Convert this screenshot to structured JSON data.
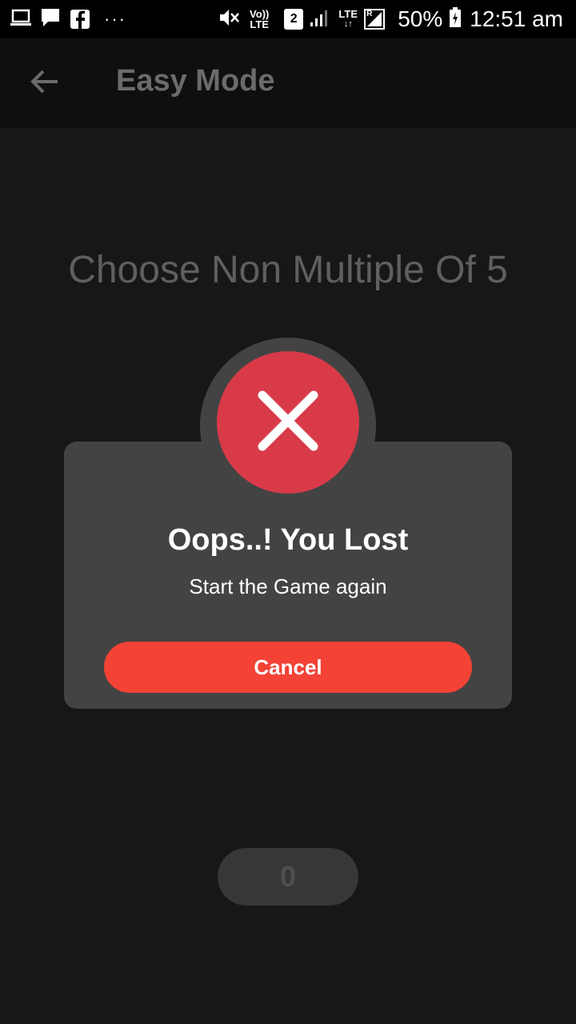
{
  "status_bar": {
    "battery_percent": "50%",
    "time": "12:51 am",
    "volte_label_top": "Vo))",
    "volte_label_bottom": "LTE",
    "sim_slot": "2",
    "lte_label": "LTE",
    "roaming_label": "R",
    "more_dots": "···",
    "icons": {
      "laptop": "laptop-icon",
      "chat": "chat-icon",
      "facebook": "facebook-icon",
      "mute": "mute-icon",
      "signal": "signal-icon",
      "battery": "battery-icon"
    }
  },
  "app_bar": {
    "title": "Easy Mode",
    "back_icon": "arrow-left-icon"
  },
  "game": {
    "prompt": "Choose Non Multiple Of 5",
    "score": "0"
  },
  "dialog": {
    "icon": "close-icon",
    "title": "Oops..! You Lost",
    "message": "Start the Game again",
    "cancel_label": "Cancel"
  },
  "colors": {
    "background": "#171717",
    "app_bar": "#0f0f0f",
    "dialog": "#434343",
    "error_badge": "#d93a48",
    "cancel_button": "#f44236"
  }
}
